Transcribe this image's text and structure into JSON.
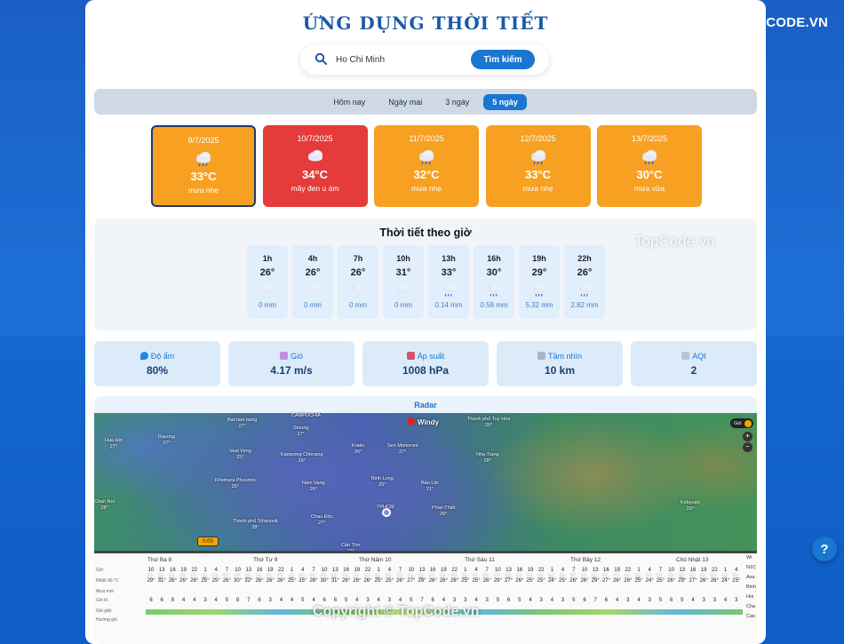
{
  "app": {
    "title": "ỨNG DỤNG THỜI TIẾT",
    "logo_text": "TOPCODE.VN",
    "help_label": "?",
    "watermark_center": "Copyright © TopCode.vn",
    "watermark_side": "TopCode.vn"
  },
  "search": {
    "value": "Ho Chi Minh",
    "button_label": "Tìm kiếm"
  },
  "tabs": [
    {
      "label": "Hôm nay",
      "active": false
    },
    {
      "label": "Ngày mai",
      "active": false
    },
    {
      "label": "3 ngày",
      "active": false
    },
    {
      "label": "5 ngày",
      "active": true
    }
  ],
  "days": [
    {
      "date": "9/7/2025",
      "temp": "33°C",
      "desc": "mưa nhẹ",
      "color": "#f7a021",
      "icon": "rain-cloud-icon",
      "selected": true
    },
    {
      "date": "10/7/2025",
      "temp": "34°C",
      "desc": "mây đen u ám",
      "color": "#e53b3b",
      "icon": "cloud-icon",
      "selected": false
    },
    {
      "date": "11/7/2025",
      "temp": "32°C",
      "desc": "mưa nhẹ",
      "color": "#f7a021",
      "icon": "rain-cloud-icon",
      "selected": false
    },
    {
      "date": "12/7/2025",
      "temp": "33°C",
      "desc": "mưa nhẹ",
      "color": "#f7a021",
      "icon": "rain-cloud-icon",
      "selected": false
    },
    {
      "date": "13/7/2025",
      "temp": "30°C",
      "desc": "mưa vừa",
      "color": "#f7a021",
      "icon": "rain-cloud-icon",
      "selected": false
    }
  ],
  "hourly": {
    "title": "Thời tiết theo giờ",
    "items": [
      {
        "time": "1h",
        "temp": "26°",
        "rain": "0 mm",
        "icon": "cloud-icon"
      },
      {
        "time": "4h",
        "temp": "26°",
        "rain": "0 mm",
        "icon": "cloud-icon"
      },
      {
        "time": "7h",
        "temp": "26°",
        "rain": "0 mm",
        "icon": "cloud-icon"
      },
      {
        "time": "10h",
        "temp": "31°",
        "rain": "0 mm",
        "icon": "cloud-icon"
      },
      {
        "time": "13h",
        "temp": "33°",
        "rain": "0.14 mm",
        "icon": "rain-cloud-icon"
      },
      {
        "time": "16h",
        "temp": "30°",
        "rain": "0.58 mm",
        "icon": "rain-cloud-icon"
      },
      {
        "time": "19h",
        "temp": "29°",
        "rain": "5.32 mm",
        "icon": "rain-cloud-icon"
      },
      {
        "time": "22h",
        "temp": "26°",
        "rain": "2.82 mm",
        "icon": "rain-cloud-icon"
      }
    ]
  },
  "stats": [
    {
      "label": "Độ ẩm",
      "value": "80%",
      "icon": "droplet-icon"
    },
    {
      "label": "Gió",
      "value": "4.17 m/s",
      "icon": "wind-icon"
    },
    {
      "label": "Áp suất",
      "value": "1008 hPa",
      "icon": "thermometer-icon"
    },
    {
      "label": "Tầm nhìn",
      "value": "10 km",
      "icon": "fog-icon"
    },
    {
      "label": "AQI",
      "value": "2",
      "icon": "air-icon"
    }
  ],
  "radar": {
    "title": "Radar",
    "windy_label": "Windy",
    "layer_label": "Gió",
    "time_badge": "0:00",
    "map_labels": [
      {
        "name": "Bat-tam-bang",
        "temp": "27°"
      },
      {
        "name": "CAMPUCHIA",
        "temp": ""
      },
      {
        "name": "Rayong",
        "temp": "27°"
      },
      {
        "name": "Hua Hin",
        "temp": "27°"
      },
      {
        "name": "Stoung",
        "temp": "27°"
      },
      {
        "name": "Veal Veng",
        "temp": "25°"
      },
      {
        "name": "Kampong Chhnang",
        "temp": "26°"
      },
      {
        "name": "Kratie",
        "temp": "26°"
      },
      {
        "name": "Sen Monorom",
        "temp": "27°"
      },
      {
        "name": "Thành phố Tuy Hòa",
        "temp": "29°"
      },
      {
        "name": "Nha Trang",
        "temp": "28°"
      },
      {
        "name": "Khemara Phoumin",
        "temp": "25°"
      },
      {
        "name": "Nam Vang",
        "temp": "26°"
      },
      {
        "name": "Binh Long",
        "temp": "25°"
      },
      {
        "name": "Bảo Lộc",
        "temp": "21°"
      },
      {
        "name": "Chau Đốc",
        "temp": "27°"
      },
      {
        "name": "TPHCM",
        "temp": ""
      },
      {
        "name": "Phan Thiết",
        "temp": "26°"
      },
      {
        "name": "Thành phố Sihanouk",
        "temp": "28°"
      },
      {
        "name": "Cần Thơ",
        "temp": "27°"
      },
      {
        "name": "Kebyuan",
        "temp": "29°"
      },
      {
        "name": "Chan Noi",
        "temp": "28°"
      }
    ],
    "forecast_days": [
      "Thứ Ba 8",
      "Thứ Tư 9",
      "Thứ Năm 10",
      "Thứ Sáu 11",
      "Thứ Bảy 12",
      "Chủ Nhật 13"
    ],
    "row_labels": [
      "Giờ",
      "Nhiệt độ °C",
      "Mưa mm",
      "Gió kt",
      "Gió giật",
      "Hướng gió"
    ],
    "hours_row": [
      "10",
      "13",
      "16",
      "19",
      "22",
      "1",
      "4",
      "7",
      "10",
      "13",
      "16",
      "19",
      "22",
      "1",
      "4",
      "7",
      "10",
      "13",
      "16",
      "19",
      "22",
      "1",
      "4",
      "7",
      "10",
      "13",
      "16",
      "19",
      "22",
      "1",
      "4",
      "7",
      "10",
      "13",
      "16",
      "19",
      "22",
      "1",
      "4",
      "7",
      "10",
      "13",
      "16",
      "19",
      "22",
      "1",
      "4",
      "7",
      "10",
      "13",
      "16",
      "19",
      "22",
      "1",
      "4"
    ],
    "temps_row": [
      "29°",
      "31°",
      "26°",
      "26°",
      "26°",
      "25°",
      "25°",
      "26°",
      "30°",
      "32°",
      "26°",
      "26°",
      "26°",
      "25°",
      "25°",
      "26°",
      "30°",
      "31°",
      "26°",
      "26°",
      "26°",
      "25°",
      "25°",
      "26°",
      "27°",
      "29°",
      "26°",
      "26°",
      "26°",
      "25°",
      "25°",
      "26°",
      "29°",
      "27°",
      "26°",
      "25°",
      "25°",
      "24°",
      "25°",
      "26°",
      "26°",
      "29°",
      "27°",
      "26°",
      "26°",
      "25°",
      "24°",
      "25°",
      "26°",
      "29°",
      "27°",
      "26°",
      "26°",
      "24°",
      "25°"
    ],
    "wind_row": [
      "6",
      "6",
      "8",
      "4",
      "4",
      "3",
      "4",
      "5",
      "8",
      "7",
      "6",
      "3",
      "4",
      "4",
      "5",
      "4",
      "6",
      "6",
      "5",
      "4",
      "3",
      "4",
      "3",
      "4",
      "5",
      "7",
      "6",
      "4",
      "3",
      "3",
      "4",
      "3",
      "5",
      "6",
      "5",
      "4",
      "3",
      "4",
      "3",
      "5",
      "6",
      "7",
      "6",
      "4",
      "3",
      "4",
      "3",
      "5",
      "6",
      "5",
      "4",
      "3",
      "3",
      "4",
      "3"
    ],
    "side_labels": [
      "Wi",
      "N1C",
      "Asa",
      "Binh",
      "Hoi",
      "Cha",
      "Cao"
    ]
  }
}
